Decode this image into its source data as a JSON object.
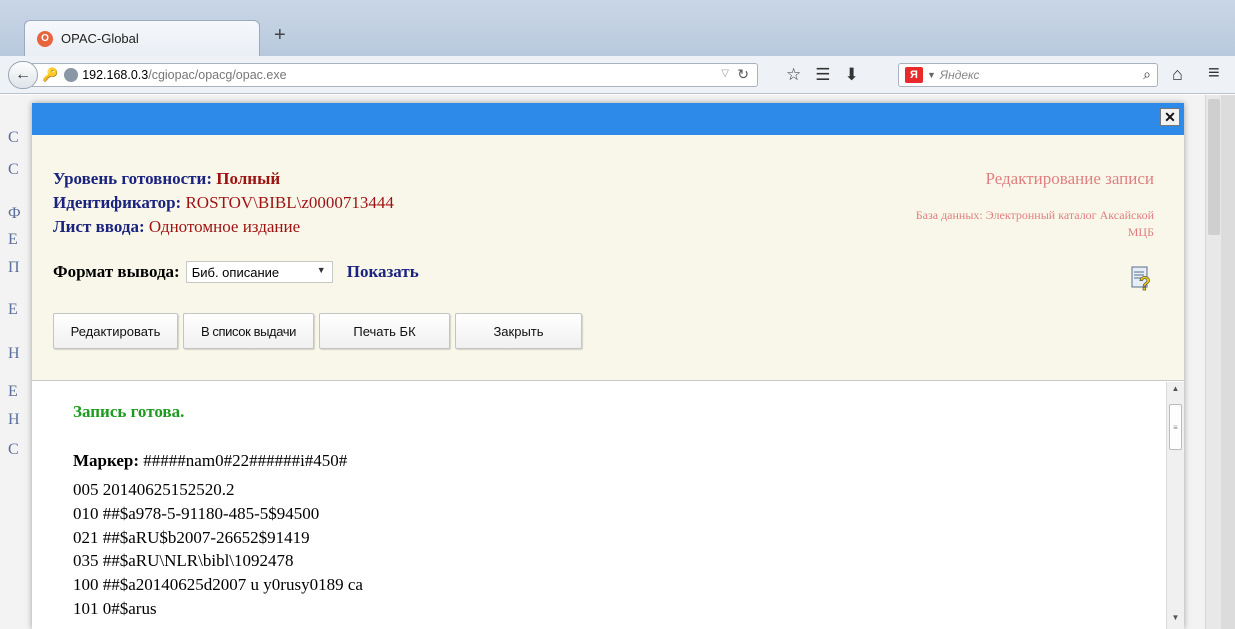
{
  "browser": {
    "tab_title": "OPAC-Global",
    "new_tab": "+",
    "url_host": "192.168.0.3",
    "url_path": "/cgiopac/opacg/opac.exe",
    "search_placeholder": "Яндекс",
    "search_engine_logo": "Я"
  },
  "dialog": {
    "close_label": "✕",
    "readiness_label": "Уровень готовности:",
    "readiness_value": "Полный",
    "identifier_label": "Идентификатор:",
    "identifier_value": "ROSTOV\\BIBL\\z0000713444",
    "input_sheet_label": "Лист ввода:",
    "input_sheet_value": "Однотомное издание",
    "edit_title": "Редактирование записи",
    "database": "База данных: Электронный каталог Аксайской МЦБ",
    "format_label": "Формат вывода:",
    "format_selected": "Биб. описание",
    "show_link": "Показать",
    "buttons": {
      "edit": "Редактировать",
      "issue_list": "В список выдачи",
      "print": "Печать БК",
      "close": "Закрыть"
    }
  },
  "record": {
    "status": "Запись готова.",
    "marker_label": "Маркер:",
    "marker_value": "#####nam0#22######i#450#",
    "fields": [
      "005 20140625152520.2",
      "010 ##$a978-5-91180-485-5$94500",
      "021 ##$aRU$b2007-26652$91419",
      "035 ##$aRU\\NLR\\bibl\\1092478",
      "100 ##$a20140625d2007 u y0rusy0189 ca",
      "101 0#$arus"
    ]
  },
  "background_page": {
    "letters": [
      "С",
      "С",
      "Ф",
      "Е",
      "П",
      "Е",
      "Н",
      "Е",
      "Н",
      "С"
    ]
  },
  "colors": {
    "title_bar": "#2e8ae8",
    "header_bg": "#f8f7ea",
    "label_color": "#1a237e",
    "value_color": "#9e1212",
    "status_green": "#1e9b1e",
    "edit_title_color": "#e07f7f"
  },
  "icons": {
    "back": "back-arrow-icon",
    "lock": "key-icon",
    "site": "globe-icon",
    "reload": "reload-icon",
    "bookmark_star": "star-icon",
    "bookmarks": "bookmarks-list-icon",
    "downloads": "download-icon",
    "search": "search-icon",
    "home": "home-icon",
    "menu": "hamburger-menu-icon",
    "help": "help-document-icon"
  }
}
